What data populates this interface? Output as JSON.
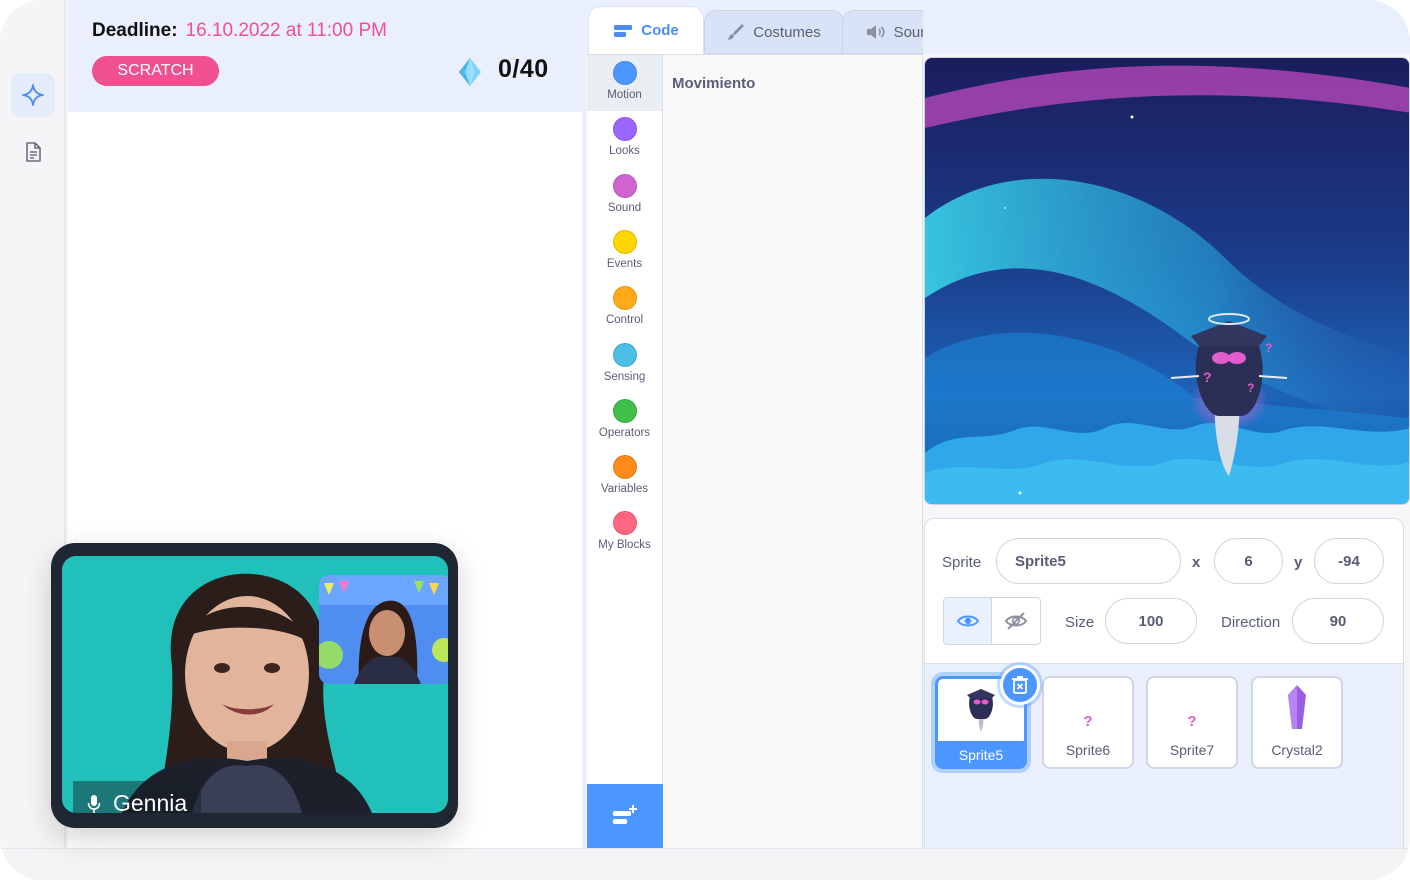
{
  "sidebar": {
    "items": [
      {
        "icon": "sparkle-icon",
        "active": true
      },
      {
        "icon": "document-icon",
        "active": false
      }
    ]
  },
  "task": {
    "deadline_label": "Deadline:",
    "deadline_value": "16.10.2022 at 11:00 PM",
    "tag": "SCRATCH",
    "gem_icon": "diamond-icon",
    "score": "0/40"
  },
  "tabs": {
    "code": "Code",
    "costumes": "Costumes",
    "sounds": "Sounds"
  },
  "categories": [
    {
      "label": "Motion",
      "color": "#4c97ff"
    },
    {
      "label": "Looks",
      "color": "#9966ff"
    },
    {
      "label": "Sound",
      "color": "#cf63cf"
    },
    {
      "label": "Events",
      "color": "#ffd500"
    },
    {
      "label": "Control",
      "color": "#ffab19"
    },
    {
      "label": "Sensing",
      "color": "#4cbfe6"
    },
    {
      "label": "Operators",
      "color": "#40bf4a"
    },
    {
      "label": "Variables",
      "color": "#ff8c1a"
    },
    {
      "label": "My Blocks",
      "color": "#ff6680"
    }
  ],
  "palette": {
    "title": "Movimiento"
  },
  "sprite_info": {
    "sprite_label": "Sprite",
    "sprite_name": "Sprite5",
    "x_label": "x",
    "x_value": "6",
    "y_label": "y",
    "y_value": "-94",
    "show_label": "Show",
    "size_label": "Size",
    "size_value": "100",
    "direction_label": "Direction",
    "direction_value": "90"
  },
  "sprites": [
    {
      "name": "Sprite5",
      "selected": true
    },
    {
      "name": "Sprite6",
      "selected": false
    },
    {
      "name": "Sprite7",
      "selected": false
    },
    {
      "name": "Crystal2",
      "selected": false
    }
  ],
  "video": {
    "participant_name": "Gennia"
  },
  "colors": {
    "accent": "#4c97ff",
    "brand_pink": "#f0508f",
    "panel_bg": "#e9effc"
  }
}
